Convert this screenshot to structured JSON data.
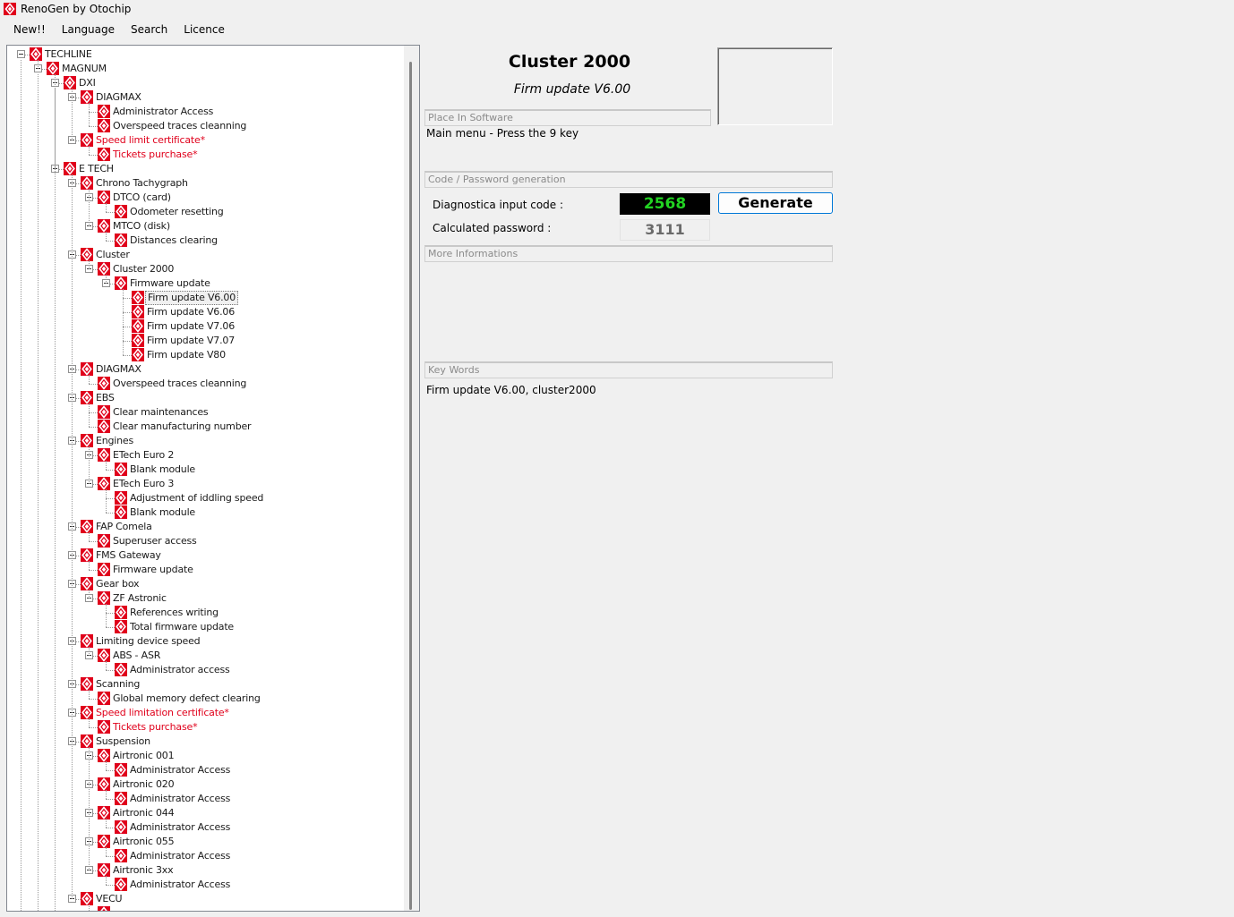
{
  "window": {
    "title": "RenoGen by Otochip"
  },
  "menu": [
    "New!!",
    "Language",
    "Search",
    "Licence"
  ],
  "tree": [
    {
      "label": "TECHLINE",
      "level": 0,
      "exp": true
    },
    {
      "label": "MAGNUM",
      "level": 1,
      "exp": true
    },
    {
      "label": "DXI",
      "level": 2,
      "exp": true
    },
    {
      "label": "DIAGMAX",
      "level": 3,
      "exp": true
    },
    {
      "label": "Administrator Access",
      "level": 4
    },
    {
      "label": "Overspeed traces cleanning",
      "level": 4
    },
    {
      "label": "Speed limit certificate*",
      "level": 3,
      "exp": true,
      "red": true
    },
    {
      "label": "Tickets purchase*",
      "level": 4,
      "red": true
    },
    {
      "label": "E TECH",
      "level": 2,
      "exp": true
    },
    {
      "label": "Chrono Tachygraph",
      "level": 3,
      "exp": true
    },
    {
      "label": "DTCO (card)",
      "level": 4,
      "exp": true
    },
    {
      "label": "Odometer resetting",
      "level": 5
    },
    {
      "label": "MTCO (disk)",
      "level": 4,
      "exp": true
    },
    {
      "label": "Distances clearing",
      "level": 5
    },
    {
      "label": "Cluster",
      "level": 3,
      "exp": true
    },
    {
      "label": "Cluster 2000",
      "level": 4,
      "exp": true
    },
    {
      "label": "Firmware update",
      "level": 5,
      "exp": true
    },
    {
      "label": "Firm update V6.00",
      "level": 6,
      "selected": true
    },
    {
      "label": "Firm update V6.06",
      "level": 6
    },
    {
      "label": "Firm update V7.06",
      "level": 6
    },
    {
      "label": "Firm update V7.07",
      "level": 6
    },
    {
      "label": "Firm update V80",
      "level": 6
    },
    {
      "label": "DIAGMAX",
      "level": 3,
      "exp": true
    },
    {
      "label": "Overspeed traces cleanning",
      "level": 4
    },
    {
      "label": "EBS",
      "level": 3,
      "exp": true
    },
    {
      "label": "Clear maintenances",
      "level": 4
    },
    {
      "label": "Clear manufacturing number",
      "level": 4
    },
    {
      "label": "Engines",
      "level": 3,
      "exp": true
    },
    {
      "label": "ETech Euro 2",
      "level": 4,
      "exp": true
    },
    {
      "label": "Blank module",
      "level": 5
    },
    {
      "label": "ETech Euro 3",
      "level": 4,
      "exp": true
    },
    {
      "label": "Adjustment of iddling speed",
      "level": 5
    },
    {
      "label": "Blank module",
      "level": 5
    },
    {
      "label": "FAP Comela",
      "level": 3,
      "exp": true
    },
    {
      "label": "Superuser access",
      "level": 4
    },
    {
      "label": "FMS Gateway",
      "level": 3,
      "exp": true
    },
    {
      "label": "Firmware update",
      "level": 4
    },
    {
      "label": "Gear box",
      "level": 3,
      "exp": true
    },
    {
      "label": "ZF Astronic",
      "level": 4,
      "exp": true
    },
    {
      "label": "References writing",
      "level": 5
    },
    {
      "label": "Total firmware update",
      "level": 5
    },
    {
      "label": "Limiting device speed",
      "level": 3,
      "exp": true
    },
    {
      "label": "ABS - ASR",
      "level": 4,
      "exp": true
    },
    {
      "label": "Administrator access",
      "level": 5
    },
    {
      "label": "Scanning",
      "level": 3,
      "exp": true
    },
    {
      "label": "Global memory defect clearing",
      "level": 4
    },
    {
      "label": "Speed limitation certificate*",
      "level": 3,
      "exp": true,
      "red": true
    },
    {
      "label": "Tickets purchase*",
      "level": 4,
      "red": true
    },
    {
      "label": "Suspension",
      "level": 3,
      "exp": true
    },
    {
      "label": "Airtronic 001",
      "level": 4,
      "exp": true
    },
    {
      "label": "Administrator Access",
      "level": 5
    },
    {
      "label": "Airtronic 020",
      "level": 4,
      "exp": true
    },
    {
      "label": "Administrator Access",
      "level": 5
    },
    {
      "label": "Airtronic 044",
      "level": 4,
      "exp": true
    },
    {
      "label": "Administrator Access",
      "level": 5
    },
    {
      "label": "Airtronic 055",
      "level": 4,
      "exp": true
    },
    {
      "label": "Administrator Access",
      "level": 5
    },
    {
      "label": "Airtronic 3xx",
      "level": 4,
      "exp": true
    },
    {
      "label": "Administrator Access",
      "level": 5
    },
    {
      "label": "VECU",
      "level": 3,
      "exp": true
    },
    {
      "label": "",
      "level": 4
    }
  ],
  "details": {
    "title": "Cluster 2000",
    "subtitle": "Firm update V6.00",
    "place_header": "Place In Software",
    "place_text": "Main menu - Press the 9 key",
    "code_header": "Code / Password generation",
    "input_label": "Diagnostica input code :",
    "input_value": "2568",
    "password_label": "Calculated password :",
    "password_value": "3111",
    "generate_label": "Generate",
    "more_header": "More Informations",
    "keywords_header": "Key Words",
    "keywords_text": "Firm update V6.00, cluster2000"
  },
  "colors": {
    "brand_red": "#e0001b",
    "code_green": "#22d322",
    "accent_blue": "#0078d7"
  }
}
